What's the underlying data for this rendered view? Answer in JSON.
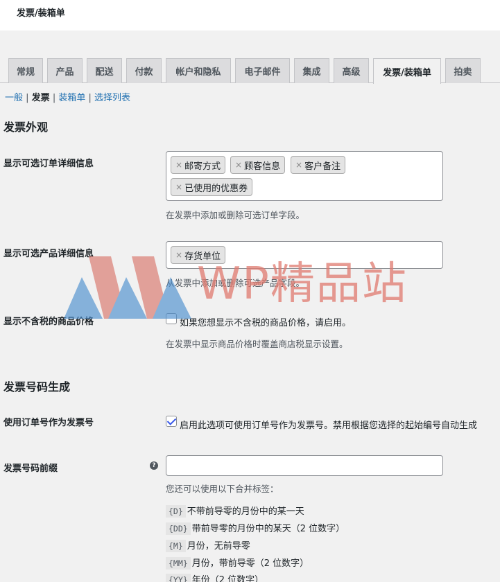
{
  "page": {
    "title": "发票/装箱单"
  },
  "tabs": [
    {
      "label": "常规"
    },
    {
      "label": "产品"
    },
    {
      "label": "配送"
    },
    {
      "label": "付款"
    },
    {
      "label": "帐户和隐私"
    },
    {
      "label": "电子邮件"
    },
    {
      "label": "集成"
    },
    {
      "label": "高级"
    },
    {
      "label": "发票/装箱单"
    },
    {
      "label": "拍卖"
    }
  ],
  "subnav": {
    "general": "一般",
    "invoice": "发票",
    "packing": "装箱单",
    "picklist": "选择列表"
  },
  "appearance": {
    "heading": "发票外观",
    "order_details": {
      "label": "显示可选订单详细信息",
      "chips": [
        "邮寄方式",
        "顾客信息",
        "客户备注",
        "已使用的优惠券"
      ],
      "desc": "在发票中添加或删除可选订单字段。"
    },
    "product_details": {
      "label": "显示可选产品详细信息",
      "chips": [
        "存货单位"
      ],
      "desc": "从发票中添加或删除可选产品字段。"
    },
    "tax_free": {
      "label": "显示不含税的商品价格",
      "checkbox_label": "如果您想显示不含税的商品价格，请启用。",
      "desc": "在发票中显示商品价格时覆盖商店税显示设置。"
    }
  },
  "numbering": {
    "heading": "发票号码生成",
    "use_order_number": {
      "label": "使用订单号作为发票号",
      "checkbox_label": "启用此选项可使用订单号作为发票号。禁用根据您选择的起始编号自动生成"
    },
    "prefix": {
      "label": "发票号码前缀",
      "help": "?",
      "value": "",
      "desc": "您还可以使用以下合并标签："
    },
    "tags": [
      {
        "code": "{D}",
        "text": "不带前导零的月份中的某一天"
      },
      {
        "code": "{DD}",
        "text": "带前导零的月份中的某天（2 位数字）"
      },
      {
        "code": "{M}",
        "text": "月份，无前导零"
      },
      {
        "code": "{MM}",
        "text": "月份，带前导零（2 位数字）"
      },
      {
        "code": "{YY}",
        "text": "年份（2 位数字）"
      }
    ]
  },
  "watermark": {
    "text": "WP精品站"
  }
}
